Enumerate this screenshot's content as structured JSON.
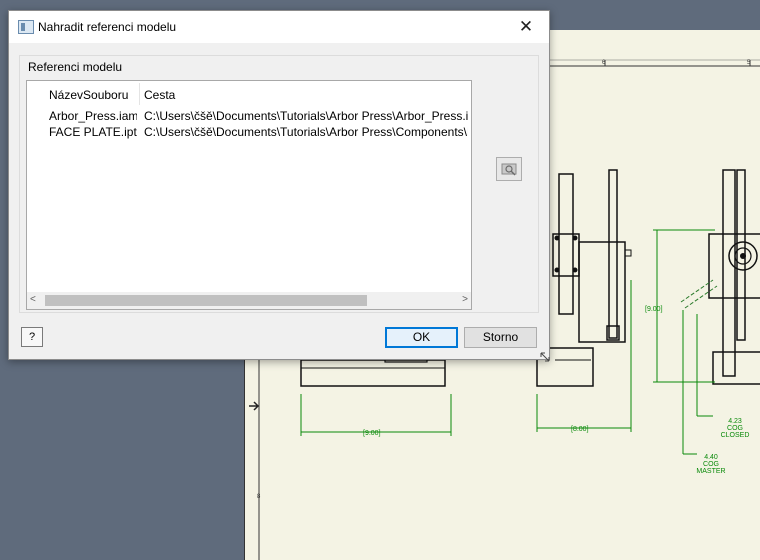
{
  "dialog": {
    "title": "Nahradit referenci modelu",
    "close_glyph": "✕",
    "group_label": "Referenci modelu",
    "columns": [
      "NázevSouboru",
      "Cesta"
    ],
    "rows": [
      {
        "name": "Arbor_Press.iam",
        "path": "C:\\Users\\čšě\\Documents\\Tutorials\\Arbor Press\\Arbor_Press.iam"
      },
      {
        "name": "FACE PLATE.ipt",
        "path": "C:\\Users\\čšě\\Documents\\Tutorials\\Arbor Press\\Components\\FACE PLATE.ipt"
      }
    ],
    "help_label": "?",
    "ok_label": "OK",
    "cancel_label": "Storno",
    "scroll_left": "<",
    "scroll_right": ">"
  },
  "drawing": {
    "top_ticks": [
      "6",
      "5"
    ],
    "side_tick": "8",
    "dim_left": "[9.00]",
    "dim_mid": "[8.00]",
    "dim_vert": "[9.00]",
    "cog_closed": {
      "value": "4.23",
      "line1": "COG",
      "line2": "CLOSED"
    },
    "cog_master": {
      "value": "4.40",
      "line1": "COG",
      "line2": "MASTER"
    }
  },
  "icons": {
    "app": "window-icon",
    "browse": "browse-folder-icon",
    "resize": "resize-grip-icon"
  }
}
